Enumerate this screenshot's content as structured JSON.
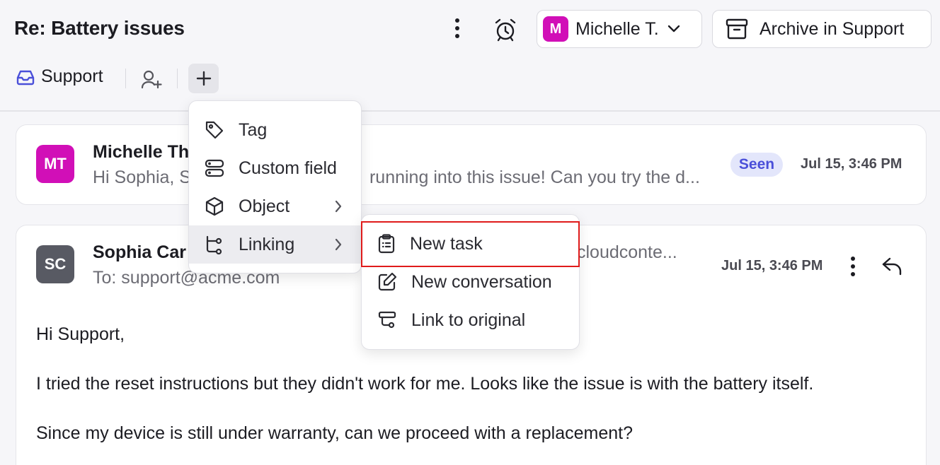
{
  "header": {
    "title": "Re: Battery issues",
    "assignee": {
      "initial": "M",
      "name": "Michelle T."
    },
    "archive_label": "Archive in Support",
    "inbox_label": "Support"
  },
  "messages": [
    {
      "avatar": "MT",
      "sender": "Michelle Th",
      "preview_left": "Hi Sophia, S",
      "preview_right": "running into this issue! Can you try the d...",
      "badge": "Seen",
      "time": "Jul 15, 3:46 PM"
    },
    {
      "avatar": "SC",
      "sender": "Sophia Car",
      "sender_email_tail": "cloudconte...",
      "to": "To: support@acme.com",
      "time": "Jul 15, 3:46 PM",
      "body": [
        "Hi Support,",
        "I tried the reset instructions but they didn't work for me. Looks like the issue is with the battery itself.",
        "Since my device is still under warranty, can we proceed with a replacement?"
      ]
    }
  ],
  "add_menu": {
    "items": [
      {
        "label": "Tag",
        "icon": "tag-icon"
      },
      {
        "label": "Custom field",
        "icon": "custom-field-icon"
      },
      {
        "label": "Object",
        "icon": "cube-icon"
      },
      {
        "label": "Linking",
        "icon": "linking-icon"
      }
    ]
  },
  "linking_menu": {
    "items": [
      {
        "label": "New task",
        "icon": "clipboard-icon"
      },
      {
        "label": "New conversation",
        "icon": "edit-icon"
      },
      {
        "label": "Link to original",
        "icon": "link-original-icon"
      }
    ]
  },
  "colors": {
    "accent": "#4a4fd9",
    "avatar_pink": "#d10fb7",
    "avatar_gray": "#585a63",
    "highlight": "#e01b1b"
  }
}
